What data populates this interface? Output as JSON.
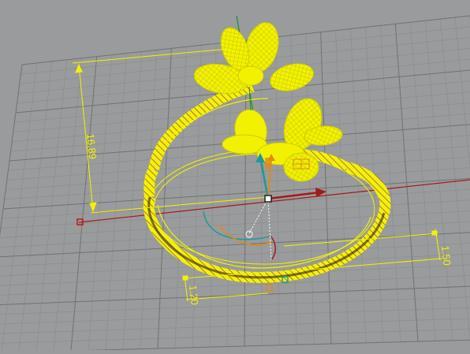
{
  "viewport": {
    "background": "#9a9b9c",
    "grid_minor": "#8a8b8c",
    "grid_major": "#6f7071",
    "selection_color": "#f2f200",
    "x_axis_color": "#a11a1a",
    "y_axis_color": "#1e8f1e",
    "z_axis_color": "#1f9a9a"
  },
  "dimensions": {
    "height": "16.89",
    "band_width": "1.50",
    "band_thickness": "1.20"
  },
  "icons": {
    "gumball": "gumball-icon",
    "pivot": "pivot-point-icon",
    "origin_marker": "origin-marker-icon"
  }
}
